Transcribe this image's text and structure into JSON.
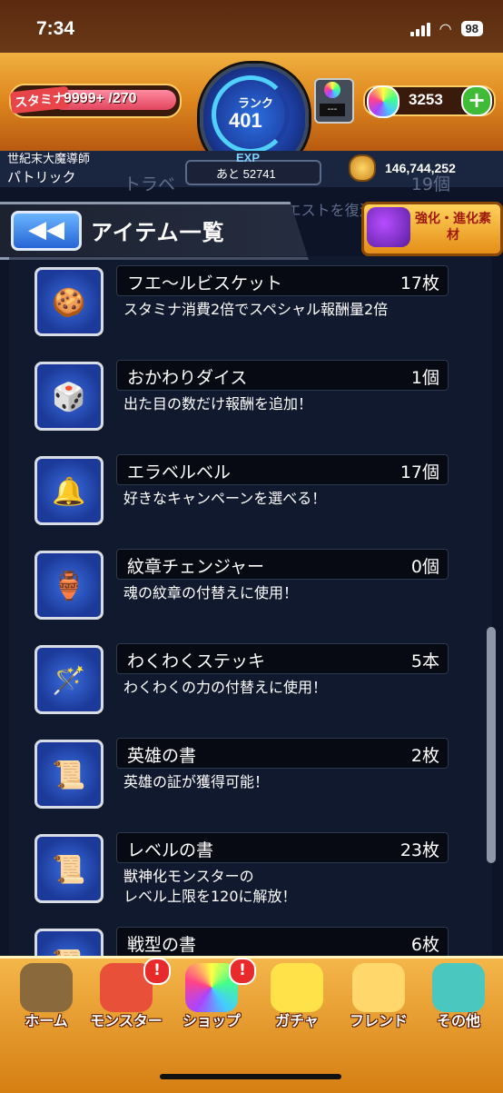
{
  "status": {
    "time": "7:34",
    "battery": "98"
  },
  "header": {
    "stamina_label": "スタミナ",
    "stamina_value": "9999+ /270",
    "rank_label": "ランク",
    "rank_value": "401",
    "exp_label": "EXP",
    "exp_remaining": "あと 52741",
    "device_text": "---",
    "orb_value": "3253",
    "plus_label": "+",
    "player_title": "世紀末大魔導師",
    "player_name": "パトリック",
    "coin_value": "146,744,252"
  },
  "ghost_item": {
    "name": "トラベ",
    "count": "19個",
    "desc": "タイムシフトで好きなクエストを復活できる"
  },
  "titlebar": {
    "back_label": "◀◀",
    "title": "アイテム一覧",
    "material_button": "強化・進化素材"
  },
  "items": [
    {
      "name": "フエ〜ルビスケット",
      "count": "17枚",
      "desc": "スタミナ消費2倍でスペシャル報酬量2倍",
      "icon": "biscuit-icon",
      "glyph": "🍪"
    },
    {
      "name": "おかわりダイス",
      "count": "1個",
      "desc": "出た目の数だけ報酬を追加！",
      "icon": "dice-icon",
      "glyph": "🎲"
    },
    {
      "name": "エラベルベル",
      "count": "17個",
      "desc": "好きなキャンペーンを選べる！",
      "icon": "bell-icon",
      "glyph": "🔔"
    },
    {
      "name": "紋章チェンジャー",
      "count": "0個",
      "desc": "魂の紋章の付替えに使用！",
      "icon": "emblem-changer-icon",
      "glyph": "🏺"
    },
    {
      "name": "わくわくステッキ",
      "count": "5本",
      "desc": "わくわくの力の付替えに使用！",
      "icon": "wand-icon",
      "glyph": "🪄"
    },
    {
      "name": "英雄の書",
      "count": "2枚",
      "desc": "英雄の証が獲得可能！",
      "icon": "hero-book-icon",
      "glyph": "📜"
    },
    {
      "name": "レベルの書",
      "count": "23枚",
      "desc": "獣神化モンスターの\nレベル上限を120に解放！",
      "icon": "level-book-icon",
      "glyph": "📜"
    },
    {
      "name": "戦型の書",
      "count": "6枚",
      "desc": "",
      "icon": "battle-book-icon",
      "glyph": "📜"
    }
  ],
  "nav": [
    {
      "label": "ホーム",
      "icon": "home-icon",
      "badge": ""
    },
    {
      "label": "モンスター",
      "icon": "monster-icon",
      "badge": "!"
    },
    {
      "label": "ショップ",
      "icon": "shop-orb-icon",
      "badge": "!"
    },
    {
      "label": "ガチャ",
      "icon": "gacha-egg-icon",
      "badge": ""
    },
    {
      "label": "フレンド",
      "icon": "friend-icon",
      "badge": ""
    },
    {
      "label": "その他",
      "icon": "other-icon",
      "badge": ""
    }
  ]
}
